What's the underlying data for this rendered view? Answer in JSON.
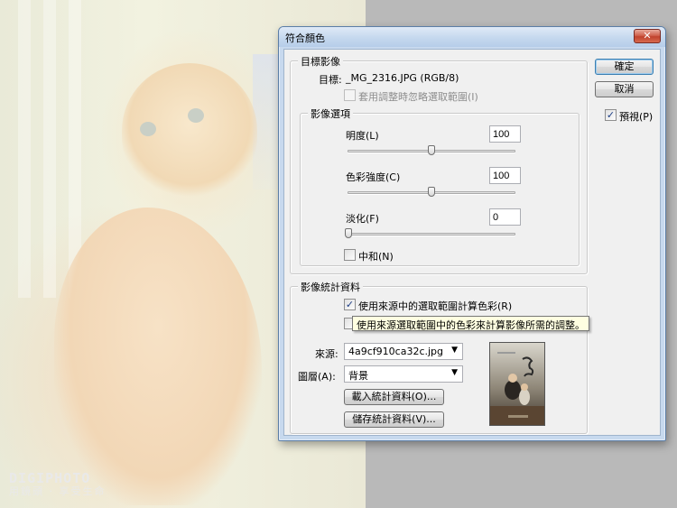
{
  "dialog": {
    "title": "符合顏色",
    "close_label": "✕"
  },
  "buttons": {
    "ok": "確定",
    "cancel": "取消",
    "load_stats": "載入統計資料(O)...",
    "save_stats": "儲存統計資料(V)..."
  },
  "preview": {
    "label": "預視(P)",
    "checked": true
  },
  "target_image": {
    "group_title": "目標影像",
    "target_label": "目標:",
    "target_value": "_MG_2316.JPG (RGB/8)",
    "ignore_selection_label": "套用調整時忽略選取範圍(I)",
    "ignore_selection_checked": false,
    "ignore_selection_enabled": false
  },
  "image_options": {
    "group_title": "影像選項",
    "luminance": {
      "label": "明度(L)",
      "value": "100",
      "slider_fraction": 0.5
    },
    "color_intensity": {
      "label": "色彩強度(C)",
      "value": "100",
      "slider_fraction": 0.5
    },
    "fade": {
      "label": "淡化(F)",
      "value": "0",
      "slider_fraction": 0.0
    },
    "neutralize": {
      "label": "中和(N)",
      "checked": false
    }
  },
  "image_statistics": {
    "group_title": "影像統計資料",
    "use_selection_source_label": "使用來源中的選取範圍計算色彩(R)",
    "use_selection_source_checked": true,
    "tooltip": "使用來源選取範圍中的色彩來計算影像所需的調整。",
    "source_label": "來源:",
    "source_value": "4a9cf910ca32c.jpg",
    "layer_label": "圖層(A):",
    "layer_value": "背景"
  },
  "watermark": {
    "line1": "DIGIPHOTO",
    "line2": "用鏡頭 · 享受生命"
  },
  "colors": {
    "title_bar": "#c5d8ee",
    "close_button": "#c0432e",
    "dialog_bg": "#f0f0f0",
    "tooltip_bg": "#ffffe1",
    "desktop_gray": "#b9b9b9"
  }
}
